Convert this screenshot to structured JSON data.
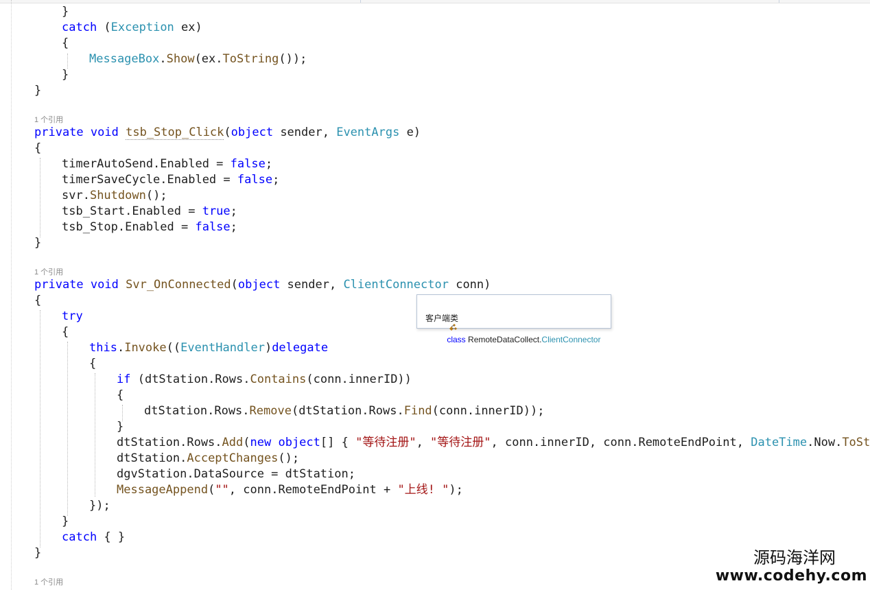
{
  "code": {
    "lines": [
      [
        "}"
      ],
      [
        "catch (Exception ex)"
      ],
      [
        "{"
      ],
      [
        "MessageBox.Show(ex.ToString());"
      ],
      [
        "}"
      ],
      [
        "}"
      ],
      [
        "private void tsb_Stop_Click(object sender, EventArgs e)"
      ],
      [
        "{"
      ],
      [
        "timerAutoSend.Enabled = false;"
      ],
      [
        "timerSaveCycle.Enabled = false;"
      ],
      [
        "svr.Shutdown();"
      ],
      [
        "tsb_Start.Enabled = true;"
      ],
      [
        "tsb_Stop.Enabled = false;"
      ],
      [
        "}"
      ],
      [
        "private void Svr_OnConnected(object sender, ClientConnector conn)"
      ],
      [
        "{"
      ],
      [
        "try"
      ],
      [
        "{"
      ],
      [
        "this.Invoke((EventHandler)delegate"
      ],
      [
        "{"
      ],
      [
        "if (dtStation.Rows.Contains(conn.innerID))"
      ],
      [
        "{"
      ],
      [
        "dtStation.Rows.Remove(dtStation.Rows.Find(conn.innerID));"
      ],
      [
        "}"
      ],
      [
        "dtStation.Rows.Add(new object[] { \"等待注册\", \"等待注册\", conn.innerID, conn.RemoteEndPoint, DateTime.Now.ToStr"
      ],
      [
        "dtStation.AcceptChanges();"
      ],
      [
        "dgvStation.DataSource = dtStation;"
      ],
      [
        "MessageAppend(\"\", conn.RemoteEndPoint + \"上线! \");"
      ],
      [
        "});"
      ],
      [
        "}"
      ],
      [
        "catch { }"
      ],
      [
        "}"
      ]
    ],
    "codelens": [
      "1 个引用",
      "1 个引用",
      "1 个引用"
    ],
    "tokens": {
      "l0": "}",
      "l1a": "catch",
      "l1b": " (",
      "l1c": "Exception",
      "l1d": " ex)",
      "l2": "{",
      "l3a": "MessageBox",
      "l3b": ".",
      "l3c": "Show",
      "l3d": "(ex.",
      "l3e": "ToString",
      "l3f": "());",
      "l4": "}",
      "l5": "}",
      "l6a": "private",
      "l6b": " ",
      "l6c": "void",
      "l6d": " ",
      "l6e": "tsb_Stop_Click",
      "l6f": "(",
      "l6g": "object",
      "l6h": " sender, ",
      "l6i": "EventArgs",
      "l6j": " e)",
      "l7": "{",
      "l8a": "timerAutoSend.Enabled = ",
      "l8b": "false",
      "l8c": ";",
      "l9a": "timerSaveCycle.Enabled = ",
      "l9b": "false",
      "l9c": ";",
      "l10a": "svr.",
      "l10b": "Shutdown",
      "l10c": "();",
      "l11a": "tsb_Start.Enabled = ",
      "l11b": "true",
      "l11c": ";",
      "l12a": "tsb_Stop.Enabled = ",
      "l12b": "false",
      "l12c": ";",
      "l13": "}",
      "l14a": "private",
      "l14b": " ",
      "l14c": "void",
      "l14d": " ",
      "l14e": "Svr_OnConnected",
      "l14f": "(",
      "l14g": "object",
      "l14h": " sender, ",
      "l14i": "ClientConnector",
      "l14j": " conn)",
      "l15": "{",
      "l16": "try",
      "l17": "{",
      "l18a": "this",
      "l18b": ".",
      "l18c": "Invoke",
      "l18d": "((",
      "l18e": "EventHandler",
      "l18f": ")",
      "l18g": "delegate",
      "l19": "{",
      "l20a": "if",
      "l20b": " (dtStation.Rows.",
      "l20c": "Contains",
      "l20d": "(conn.innerID))",
      "l21": "{",
      "l22a": "dtStation.Rows.",
      "l22b": "Remove",
      "l22c": "(dtStation.Rows.",
      "l22d": "Find",
      "l22e": "(conn.innerID));",
      "l23": "}",
      "l24a": "dtStation.Rows.",
      "l24b": "Add",
      "l24c": "(",
      "l24d": "new",
      "l24e": " ",
      "l24f": "object",
      "l24g": "[] { ",
      "l24h": "\"等待注册\"",
      "l24i": ", ",
      "l24j": "\"等待注册\"",
      "l24k": ", conn.innerID, conn.RemoteEndPoint, ",
      "l24l": "DateTime",
      "l24m": ".Now.",
      "l24n": "ToStr",
      "l25a": "dtStation.",
      "l25b": "AcceptChanges",
      "l25c": "();",
      "l26": "dgvStation.DataSource = dtStation;",
      "l27a": "MessageAppend",
      "l27b": "(",
      "l27c": "\"\"",
      "l27d": ", conn.RemoteEndPoint + ",
      "l27e": "\"上线! \"",
      "l27f": ");",
      "l28": "});",
      "l29": "}",
      "l30a": "catch",
      "l30b": " { }",
      "l31": "}"
    }
  },
  "tooltip": {
    "keyword": "class",
    "namespace": "RemoteDataCollect.",
    "type": "ClientConnector",
    "description": "客户端类",
    "icon": "class-icon"
  },
  "watermark": {
    "name": "源码海洋网",
    "url": "www.codehy.com"
  },
  "colors": {
    "keyword": "#0000ff",
    "type": "#2b91af",
    "method": "#74531f",
    "string": "#a31515",
    "text": "#1e1e1e",
    "codelens": "#8a8a8a"
  }
}
